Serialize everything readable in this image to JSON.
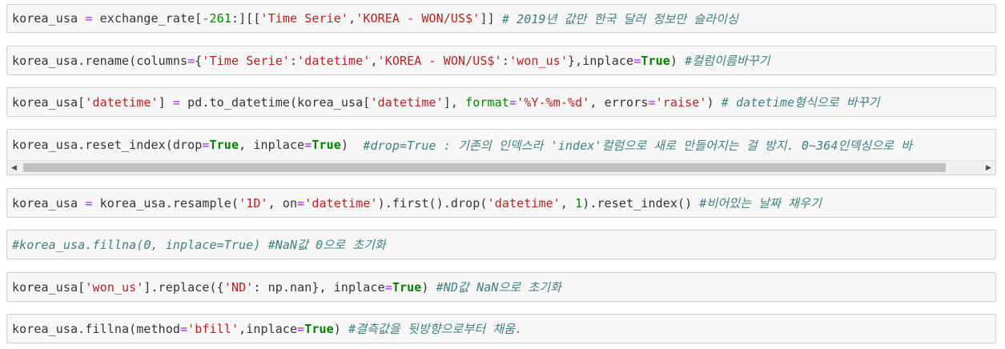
{
  "cells": [
    {
      "tokens": [
        {
          "t": "korea_usa ",
          "c": ""
        },
        {
          "t": "=",
          "c": "op"
        },
        {
          "t": " exchange_rate[",
          "c": ""
        },
        {
          "t": "-261",
          "c": "num"
        },
        {
          "t": ":][[",
          "c": ""
        },
        {
          "t": "'Time Serie'",
          "c": "str"
        },
        {
          "t": ",",
          "c": ""
        },
        {
          "t": "'KOREA - WON/US$'",
          "c": "str"
        },
        {
          "t": "]] ",
          "c": ""
        },
        {
          "t": "# 2019년 값만 한국 달러 정보만 슬라이싱",
          "c": "com"
        }
      ]
    },
    {
      "tokens": [
        {
          "t": "korea_usa.rename(columns",
          "c": ""
        },
        {
          "t": "=",
          "c": "op"
        },
        {
          "t": "{",
          "c": ""
        },
        {
          "t": "'Time Serie'",
          "c": "str"
        },
        {
          "t": ":",
          "c": ""
        },
        {
          "t": "'datetime'",
          "c": "str"
        },
        {
          "t": ",",
          "c": ""
        },
        {
          "t": "'KOREA - WON/US$'",
          "c": "str"
        },
        {
          "t": ":",
          "c": ""
        },
        {
          "t": "'won_us'",
          "c": "str"
        },
        {
          "t": "},inplace",
          "c": ""
        },
        {
          "t": "=",
          "c": "op"
        },
        {
          "t": "True",
          "c": "kw"
        },
        {
          "t": ") ",
          "c": ""
        },
        {
          "t": "#컬럼이름바꾸기",
          "c": "com"
        }
      ]
    },
    {
      "tokens": [
        {
          "t": "korea_usa[",
          "c": ""
        },
        {
          "t": "'datetime'",
          "c": "str"
        },
        {
          "t": "] ",
          "c": ""
        },
        {
          "t": "=",
          "c": "op"
        },
        {
          "t": " pd.to_datetime(korea_usa[",
          "c": ""
        },
        {
          "t": "'datetime'",
          "c": "str"
        },
        {
          "t": "], ",
          "c": ""
        },
        {
          "t": "format",
          "c": "kw2"
        },
        {
          "t": "=",
          "c": "op"
        },
        {
          "t": "'%Y-%m-%d'",
          "c": "str"
        },
        {
          "t": ", errors",
          "c": ""
        },
        {
          "t": "=",
          "c": "op"
        },
        {
          "t": "'raise'",
          "c": "str"
        },
        {
          "t": ") ",
          "c": ""
        },
        {
          "t": "# datetime형식으로 바꾸기",
          "c": "com"
        }
      ]
    },
    {
      "tokens": [
        {
          "t": "korea_usa.reset_index(drop",
          "c": ""
        },
        {
          "t": "=",
          "c": "op"
        },
        {
          "t": "True",
          "c": "kw"
        },
        {
          "t": ", inplace",
          "c": ""
        },
        {
          "t": "=",
          "c": "op"
        },
        {
          "t": "True",
          "c": "kw"
        },
        {
          "t": ")  ",
          "c": ""
        },
        {
          "t": "#drop=True : 기존의 인덱스라 'index'컬럼으로 새로 만들어지는 걸 방지. 0~364인덱싱으로 바",
          "c": "com"
        }
      ],
      "scrollbar": {
        "left_arrow": "◀",
        "right_arrow": "▶"
      }
    },
    {
      "tokens": [
        {
          "t": "korea_usa ",
          "c": ""
        },
        {
          "t": "=",
          "c": "op"
        },
        {
          "t": " korea_usa.resample(",
          "c": ""
        },
        {
          "t": "'1D'",
          "c": "str"
        },
        {
          "t": ", on",
          "c": ""
        },
        {
          "t": "=",
          "c": "op"
        },
        {
          "t": "'datetime'",
          "c": "str"
        },
        {
          "t": ").first().drop(",
          "c": ""
        },
        {
          "t": "'datetime'",
          "c": "str"
        },
        {
          "t": ", ",
          "c": ""
        },
        {
          "t": "1",
          "c": "num"
        },
        {
          "t": ").reset_index() ",
          "c": ""
        },
        {
          "t": "#비어있는 날짜 채우기",
          "c": "com"
        }
      ]
    },
    {
      "tokens": [
        {
          "t": "#korea_usa.fillna(0, inplace=True) #NaN값 0으로 초기화",
          "c": "com"
        }
      ]
    },
    {
      "tokens": [
        {
          "t": "korea_usa[",
          "c": ""
        },
        {
          "t": "'won_us'",
          "c": "str"
        },
        {
          "t": "].replace({",
          "c": ""
        },
        {
          "t": "'ND'",
          "c": "str"
        },
        {
          "t": ": np.nan}, inplace",
          "c": ""
        },
        {
          "t": "=",
          "c": "op"
        },
        {
          "t": "True",
          "c": "kw"
        },
        {
          "t": ") ",
          "c": ""
        },
        {
          "t": "#ND값 NaN으로 초기화",
          "c": "com"
        }
      ]
    },
    {
      "tokens": [
        {
          "t": "korea_usa.fillna(method",
          "c": ""
        },
        {
          "t": "=",
          "c": "op"
        },
        {
          "t": "'bfill'",
          "c": "str"
        },
        {
          "t": ",inplace",
          "c": ""
        },
        {
          "t": "=",
          "c": "op"
        },
        {
          "t": "True",
          "c": "kw"
        },
        {
          "t": ") ",
          "c": ""
        },
        {
          "t": "#결측값을 뒷방향으로부터 채움.",
          "c": "com"
        }
      ]
    }
  ]
}
